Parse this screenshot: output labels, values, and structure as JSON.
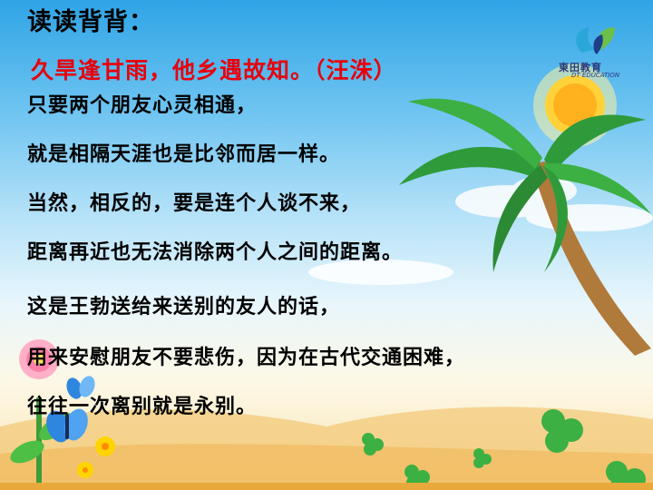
{
  "slide": {
    "title": "读读背背：",
    "subtitle": "久旱逢甘雨，他乡遇故知。（汪洙）",
    "lines": [
      "只要两个朋友心灵相通，",
      "就是相隔天涯也是比邻而居一样。",
      "当然，相反的，要是连个人谈不来，",
      "距离再近也无法消除两个人之间的距离。",
      "这是王勃送给来送别的友人的话，",
      "用来安慰朋友不要悲伤，因为在古代交通困难，",
      "往往一次离别就是永别。"
    ]
  },
  "logo": {
    "name_cn": "東田教育",
    "name_en": "DT EDUCATION"
  },
  "colors": {
    "highlight_red": "#e8000b",
    "text_black": "#000000",
    "sky_blue": "#2fa4e6",
    "sand": "#f7e3b0"
  }
}
